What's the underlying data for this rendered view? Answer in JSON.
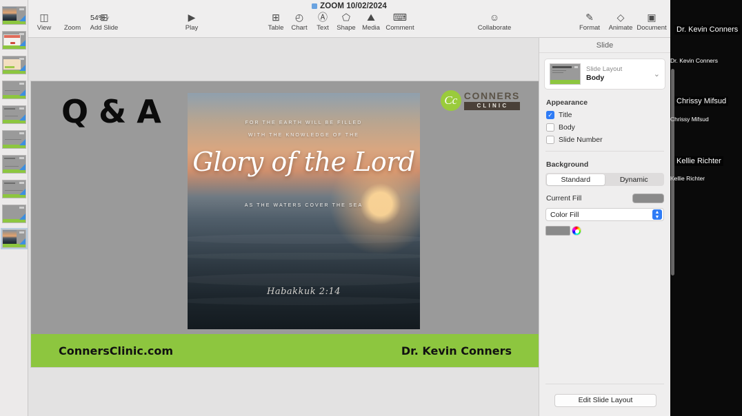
{
  "toolbar": {
    "document_title": "ZOOM 10/02/2024",
    "doc_icon": "document-icon",
    "view_label": "View",
    "view_icon": "sidebar-panel-icon",
    "zoom_value": "54%",
    "zoom_chevron": "˅",
    "zoom_label": "Zoom",
    "add_slide_label": "Add Slide",
    "add_slide_icon": "plus-box-icon",
    "play_label": "Play",
    "play_icon": "▶",
    "table_label": "Table",
    "table_icon": "⊞",
    "chart_label": "Chart",
    "chart_icon": "◴",
    "text_label": "Text",
    "text_icon": "Ⓐ",
    "shape_label": "Shape",
    "shape_icon": "⬠",
    "media_label": "Media",
    "media_icon": "⛰",
    "comment_label": "Comment",
    "comment_icon": "⌨",
    "collaborate_label": "Collaborate",
    "collaborate_icon": "☺",
    "format_label": "Format",
    "format_icon": "✎",
    "animate_label": "Animate",
    "animate_icon": "◇",
    "document_label": "Document",
    "document_icon": "▣"
  },
  "slide": {
    "title": "Q & A",
    "logo": {
      "monogram": "Cc",
      "name": "CONNERS",
      "sub": "CLINIC",
      "circle_color": "#9acb3c",
      "band_color": "#4a4038"
    },
    "verse": {
      "line1": "FOR THE EARTH WILL BE FILLED",
      "line2": "WITH THE KNOWLEDGE OF THE",
      "script": "Glory of the Lord",
      "line4": "AS THE WATERS COVER THE SEA",
      "reference": "Habakkuk 2:14"
    },
    "footer": {
      "website": "ConnersClinic.com",
      "presenter": "Dr. Kevin Conners",
      "color": "#8dc63f"
    },
    "background_color": "#9a9a9a"
  },
  "inspector": {
    "header": "Slide",
    "layout": {
      "label": "Slide Layout",
      "value": "Body",
      "thumb_title": "PRESENTATION TITLE"
    },
    "appearance": {
      "title": "Appearance",
      "options": [
        {
          "label": "Title",
          "checked": true
        },
        {
          "label": "Body",
          "checked": false
        },
        {
          "label": "Slide Number",
          "checked": false
        }
      ],
      "check_glyph": "✓"
    },
    "background": {
      "title": "Background",
      "segments": [
        {
          "label": "Standard",
          "selected": true
        },
        {
          "label": "Dynamic",
          "selected": false
        }
      ],
      "current_fill_label": "Current Fill",
      "current_fill_color": "#8a8a8a",
      "fill_type": "Color Fill",
      "stepper_glyph": "⬍",
      "color_well": "#8a8a8a"
    },
    "edit_slide_layout": "Edit Slide Layout"
  },
  "participants": [
    {
      "overlay_name": "Dr. Kevin Conners",
      "caption_name": "Dr. Kevin Conners"
    },
    {
      "overlay_name": "Chrissy Mifsud",
      "caption_name": "Chrissy Mifsud"
    },
    {
      "overlay_name": "Kellie Richter",
      "caption_name": "Kellie Richter"
    }
  ],
  "thumbnails": [
    {
      "type": "photo"
    },
    {
      "type": "card"
    },
    {
      "type": "card2"
    },
    {
      "type": "text"
    },
    {
      "type": "text"
    },
    {
      "type": "text"
    },
    {
      "type": "text"
    },
    {
      "type": "text"
    },
    {
      "type": "text"
    },
    {
      "type": "photo",
      "selected": true
    }
  ]
}
